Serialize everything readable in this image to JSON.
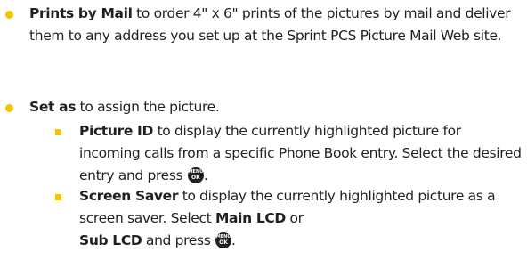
{
  "colors": {
    "bullet": "#f5c400",
    "text": "#231f20"
  },
  "items": [
    {
      "term": "Prints by Mail",
      "text": " to order 4\" x 6\" prints of the pictures by mail and deliver them to any address you set up at the Sprint PCS Picture Mail Web site."
    },
    {
      "term": "Set as",
      "text": " to assign the picture."
    }
  ],
  "subitems": [
    {
      "term": "Picture ID",
      "text": " to display the currently highlighted picture for incoming calls from a specific Phone Book entry. Select the desired entry and press "
    },
    {
      "term": "Screen Saver",
      "text_a": " to display the currently highlighted picture as a screen saver. Select ",
      "option1": "Main LCD",
      "text_b": " or ",
      "option2": "Sub LCD",
      "text_c": " and press "
    }
  ],
  "menu_key": {
    "top": "MENU",
    "bottom": "OK"
  },
  "end_punct": "."
}
